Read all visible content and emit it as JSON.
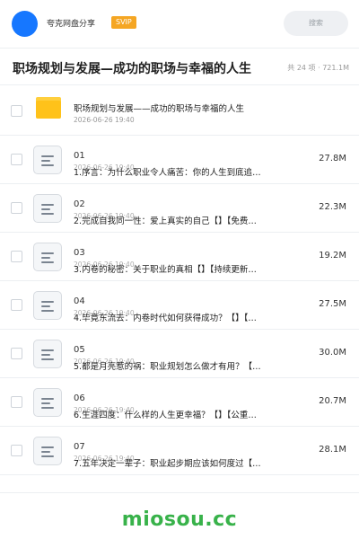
{
  "header": {
    "username": "夸克网盘分享",
    "badge": "SVIP",
    "search_placeholder": "搜索"
  },
  "share": {
    "title": "职场规划与发展—成功的职场与幸福的人生",
    "count": "共 24 项 · 721.1M"
  },
  "folder": {
    "name": "职场规划与发展——成功的职场与幸福的人生",
    "date": "2026-06-26 19:40"
  },
  "files": [
    {
      "num": "01",
      "name": "1.序言：为什么职业令人痛苦：你的人生到底追…",
      "date": "2026-06-26 19:40",
      "size": "27.8M"
    },
    {
      "num": "02",
      "name": "2.完成自我同一性：爱上真实的自己【】【免费…",
      "date": "2026-06-26 19:40",
      "size": "22.3M"
    },
    {
      "num": "03",
      "name": "3.内卷的秘密：关于职业的真相【】【持续更新…",
      "date": "2026-06-26 19:40",
      "size": "19.2M"
    },
    {
      "num": "04",
      "name": "4.毕竟东流去：内卷时代如何获得成功？【】【…",
      "date": "2026-06-26 19:40",
      "size": "27.5M"
    },
    {
      "num": "05",
      "name": "5.都是月亮惹的祸：职业规划怎么做才有用？【…",
      "date": "2026-06-26 19:40",
      "size": "30.0M"
    },
    {
      "num": "06",
      "name": "6.生涯四度：什么样的人生更幸福？【】【公重…",
      "date": "2026-06-26 19:40",
      "size": "20.7M"
    },
    {
      "num": "07",
      "name": "7.五年决定一辈子：职业起步期应该如何度过【…",
      "date": "2026-06-26 19:40",
      "size": "28.1M"
    }
  ],
  "footer": {
    "brand": "miosou.cc"
  },
  "colors": {
    "accent": "#1677ff",
    "badge": "#f5a623",
    "folder": "#ffc21a",
    "brand": "#38b24a"
  },
  "icons": {
    "folder": "folder-icon",
    "file": "document-icon",
    "avatar": "avatar"
  }
}
